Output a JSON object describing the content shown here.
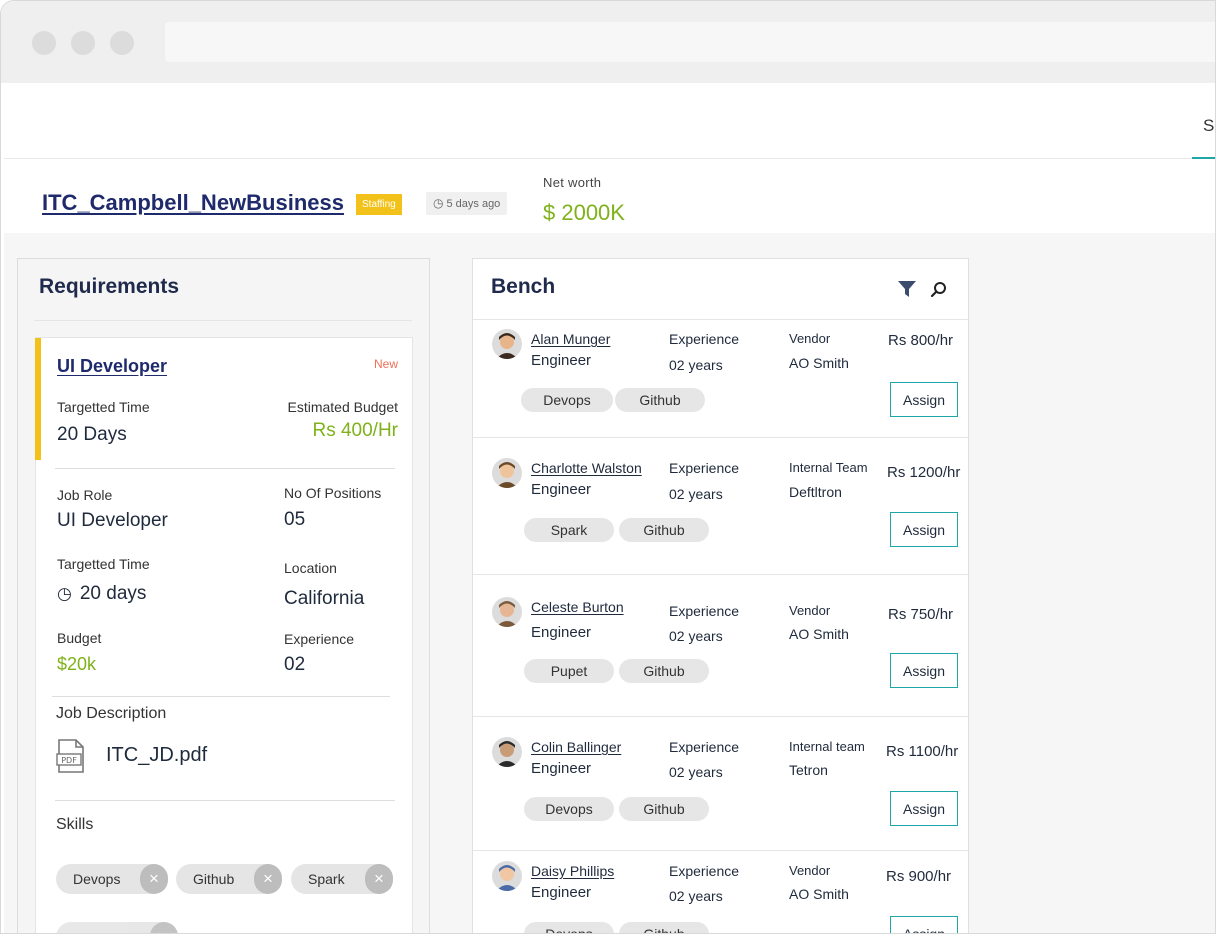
{
  "nav": {
    "tab_partial": "Sa"
  },
  "project": {
    "title": "ITC_Campbell_NewBusiness",
    "badge": "Staffing",
    "age": "5 days ago",
    "networth_label": "Net worth",
    "networth_value": "$ 2000K"
  },
  "requirements": {
    "title": "Requirements",
    "card": {
      "title": "UI Developer",
      "flag": "New",
      "targetted_time_label": "Targetted Time",
      "targetted_time_value": "20 Days",
      "estimated_budget_label": "Estimated Budget",
      "estimated_budget_value": "Rs 400/Hr",
      "job_role_label": "Job Role",
      "job_role_value": "UI Developer",
      "positions_label": "No Of Positions",
      "positions_value": "05",
      "targetted_time2_label": "Targetted Time",
      "targetted_time2_value": "20 days",
      "location_label": "Location",
      "location_value": "California",
      "budget_label": "Budget",
      "budget_value": "$20k",
      "experience_label": "Experience",
      "experience_value": "02",
      "job_description_label": "Job Description",
      "jd_file": "ITC_JD.pdf",
      "skills_label": "Skills",
      "skills": [
        "Devops",
        "Github",
        "Spark"
      ]
    }
  },
  "bench": {
    "title": "Bench",
    "assign_label": "Assign",
    "candidates": [
      {
        "name": "Alan Munger",
        "role": "Engineer",
        "exp_label": "Experience",
        "exp": "02 years",
        "org_label": "Vendor",
        "org": "AO Smith",
        "rate": "Rs 800/hr",
        "tags": [
          "Devops",
          "Github"
        ]
      },
      {
        "name": "Charlotte Walston",
        "role": "Engineer",
        "exp_label": "Experience",
        "exp": "02 years",
        "org_label": "Internal Team",
        "org": "Deftltron",
        "rate": "Rs 1200/hr",
        "tags": [
          "Spark",
          "Github"
        ]
      },
      {
        "name": "Celeste Burton",
        "role": "Engineer",
        "exp_label": "Experience",
        "exp": "02 years",
        "org_label": "Vendor",
        "org": "AO Smith",
        "rate": "Rs 750/hr",
        "tags": [
          "Pupet",
          "Github"
        ]
      },
      {
        "name": "Colin Ballinger",
        "role": "Engineer",
        "exp_label": "Experience",
        "exp": "02 years",
        "org_label": "Internal team",
        "org": "Tetron",
        "rate": "Rs 1100/hr",
        "tags": [
          "Devops",
          "Github"
        ]
      },
      {
        "name": "Daisy Phillips",
        "role": "Engineer",
        "exp_label": "Experience",
        "exp": "02 years",
        "org_label": "Vendor",
        "org": "AO Smith",
        "rate": "Rs 900/hr",
        "tags": [
          "Devops",
          "Github"
        ]
      }
    ]
  },
  "colors": {
    "accent": "#1fa6a6",
    "money": "#7fb21a",
    "staffing": "#f2c21b",
    "new": "#f07058"
  }
}
